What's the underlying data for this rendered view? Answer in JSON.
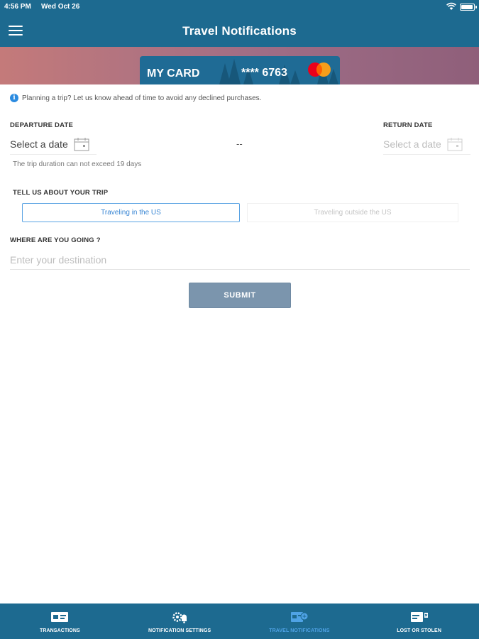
{
  "status_bar": {
    "time": "4:56 PM",
    "date": "Wed Oct 26"
  },
  "header": {
    "title": "Travel Notifications",
    "menu_icon": "hamburger-menu-icon"
  },
  "card": {
    "name": "MY CARD",
    "number": "**** 6763",
    "brand_icon": "mastercard-logo"
  },
  "info": {
    "icon": "info-icon",
    "text": "Planning a trip? Let us know ahead of time to avoid any declined purchases."
  },
  "dates": {
    "departure_label": "DEPARTURE DATE",
    "departure_placeholder": "Select a date",
    "separator": "--",
    "return_label": "RETURN DATE",
    "return_placeholder": "Select a date",
    "note": "The trip duration can not exceed 19 days"
  },
  "trip": {
    "label": "TELL US ABOUT YOUR TRIP",
    "options": [
      "Traveling in the US",
      "Traveling outside the US"
    ],
    "selected": "Traveling in the US"
  },
  "destination": {
    "label": "WHERE ARE YOU GOING ?",
    "placeholder": "Enter your destination"
  },
  "submit": {
    "label": "SUBMIT"
  },
  "tabs": [
    {
      "label": "TRANSACTIONS",
      "icon": "transactions-icon",
      "active": false
    },
    {
      "label": "NOTIFICATION SETTINGS",
      "icon": "notification-settings-icon",
      "active": false
    },
    {
      "label": "TRAVEL NOTIFICATIONS",
      "icon": "travel-notifications-icon",
      "active": true
    },
    {
      "label": "LOST OR STOLEN",
      "icon": "lost-or-stolen-icon",
      "active": false
    }
  ],
  "colors": {
    "header_bg": "#1d6a90",
    "active_tab": "#4fa3e6",
    "submit_bg": "#7b95ad",
    "selected_toggle": "#3a87d4"
  }
}
